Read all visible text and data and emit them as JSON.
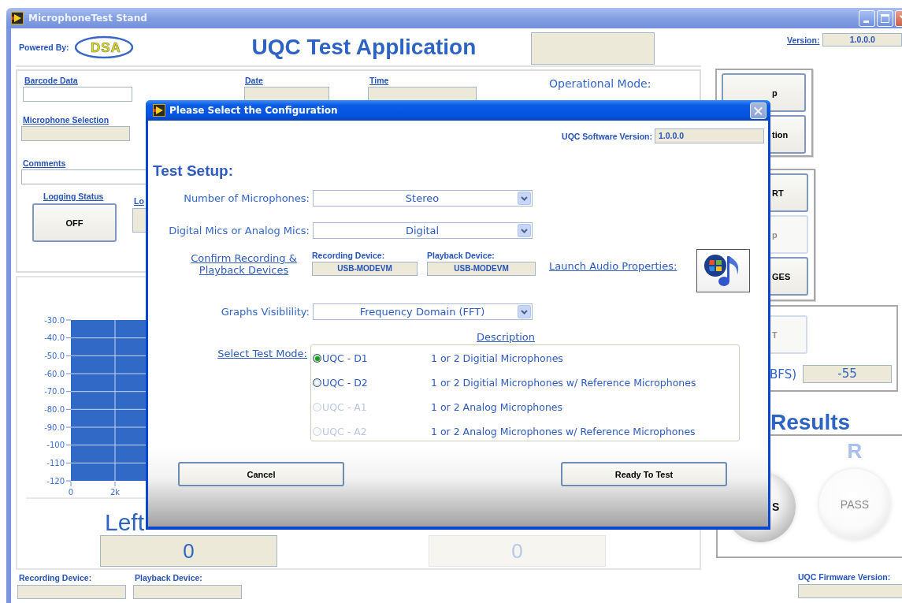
{
  "window": {
    "title": "MicrophoneTest Stand"
  },
  "header": {
    "powered_by": "Powered By:",
    "logo_text": "DSA",
    "title": "UQC Test Application",
    "version_label": "Version:",
    "version": "1.0.0.0"
  },
  "form": {
    "barcode_label": "Barcode Data",
    "date_label": "Date",
    "time_label": "Time",
    "operational_mode_label": "Operational Mode:",
    "microphone_selection_label": "Microphone Selection",
    "comments_label": "Comments",
    "logging_status_label": "Logging Status",
    "logging_button": "OFF",
    "logging_label_2": "Lo"
  },
  "control_groups": [
    {
      "buttons": [
        {
          "label": "p",
          "disabled": false
        },
        {
          "label": "tion",
          "disabled": false
        }
      ]
    },
    {
      "buttons": [
        {
          "label": "RT",
          "disabled": false
        },
        {
          "label": "p",
          "disabled": true
        },
        {
          "label": "GES",
          "disabled": false
        }
      ]
    }
  ],
  "threshold": {
    "button": {
      "label": "T",
      "disabled": true
    },
    "label": "BFS)",
    "value": "-55"
  },
  "results": {
    "title": "Results",
    "channel_label": "R",
    "lights": [
      {
        "label": "S",
        "disabled": false
      },
      {
        "label": "PASS",
        "disabled": true
      }
    ]
  },
  "graph": {
    "y_ticks": [
      "-30.0",
      "-40.0",
      "-50.0",
      "-60.0",
      "-70.0",
      "-80.0",
      "-90.0",
      "-100",
      "-110",
      "-120"
    ],
    "x_ticks": [
      "0",
      "2k"
    ]
  },
  "levels": [
    {
      "label": "Left",
      "value": "0",
      "disabled": false
    },
    {
      "value": "0",
      "disabled": true
    }
  ],
  "footer": {
    "recording_device_label": "Recording Device:",
    "playback_device_label": "Playback Device:",
    "firmware_label": "UQC Firmware Version:"
  },
  "dialog": {
    "title": "Please Select the Configuration",
    "software_version_label": "UQC Software Version:",
    "software_version": "1.0.0.0",
    "heading": "Test Setup:",
    "selectors": [
      {
        "label": "Number of Microphones:",
        "value": "Stereo"
      },
      {
        "label": "Digital Mics or Analog Mics:",
        "value": "Digital"
      }
    ],
    "devices": {
      "link": "Confirm Recording & Playback Devices",
      "recording_label": "Recording Device:",
      "recording_value": "USB-MODEVM",
      "playback_label": "Playback Device:",
      "playback_value": "USB-MODEVM",
      "launch_link": "Launch Audio Properties:"
    },
    "graphs_selector": {
      "label": "Graphs Visiblility:",
      "value": "Frequency Domain (FFT)"
    },
    "test_mode": {
      "label": "Select Test Mode:",
      "description_header": "Description",
      "modes": [
        {
          "name": "UQC - D1",
          "description": "1 or 2 Digitial Microphones",
          "selected": true,
          "disabled": false
        },
        {
          "name": "UQC - D2",
          "description": "1 or 2 Digitial Microphones w/ Reference Microphones",
          "selected": false,
          "disabled": false
        },
        {
          "name": "UQC - A1",
          "description": "1 or 2 Analog Microphones",
          "selected": false,
          "disabled": true
        },
        {
          "name": "UQC - A2",
          "description": "1 or 2 Analog Microphones w/ Reference Microphones",
          "selected": false,
          "disabled": true
        }
      ]
    },
    "buttons": [
      "Cancel",
      "Ready To Test"
    ]
  }
}
